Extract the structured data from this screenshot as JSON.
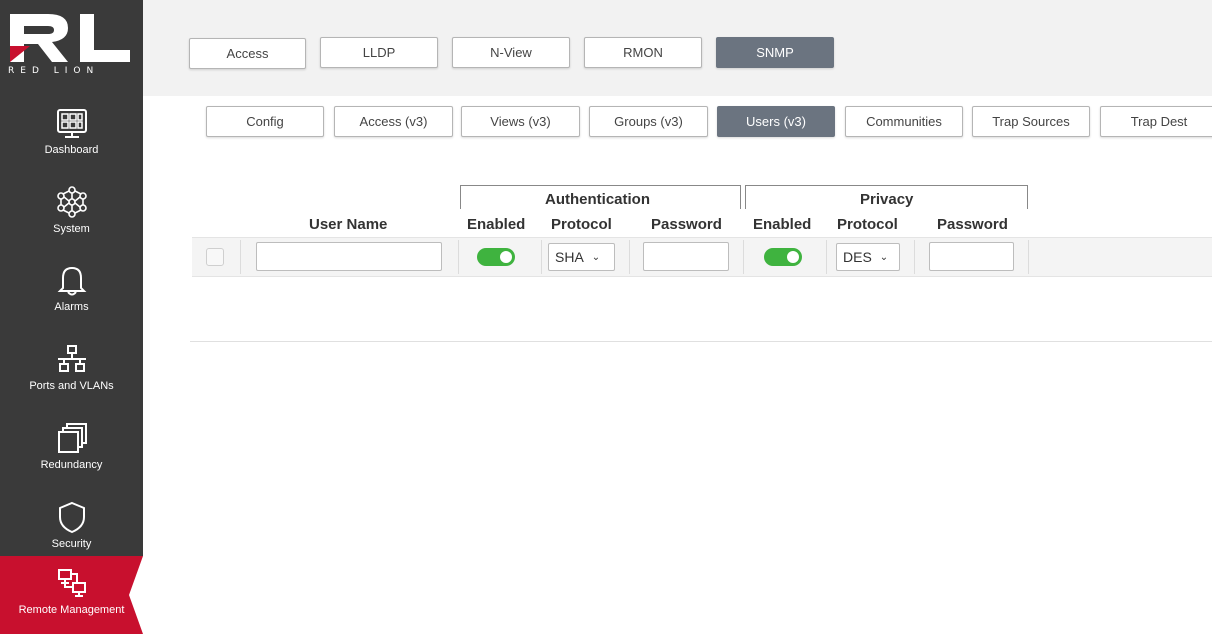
{
  "brand": {
    "wordmark": "RL",
    "name": "RED LION"
  },
  "colors": {
    "sidebar": "#3a3a3a",
    "accent": "#c8102e",
    "active_tab": "#6b7480",
    "toggle_on": "#3fb33f"
  },
  "sidebar": {
    "items": [
      {
        "label": "Dashboard",
        "icon": "dashboard-icon"
      },
      {
        "label": "System",
        "icon": "network-nodes-icon"
      },
      {
        "label": "Alarms",
        "icon": "bell-icon"
      },
      {
        "label": "Ports and VLANs",
        "icon": "port-tree-icon"
      },
      {
        "label": "Redundancy",
        "icon": "stacked-windows-icon"
      },
      {
        "label": "Security",
        "icon": "shield-icon"
      },
      {
        "label": "Remote Management",
        "icon": "remote-monitors-icon",
        "active": true
      }
    ]
  },
  "tabs_top": [
    {
      "label": "Access"
    },
    {
      "label": "LLDP"
    },
    {
      "label": "N-View"
    },
    {
      "label": "RMON"
    },
    {
      "label": "SNMP",
      "active": true
    }
  ],
  "tabs_sub": [
    {
      "label": "Config"
    },
    {
      "label": "Access (v3)"
    },
    {
      "label": "Views (v3)"
    },
    {
      "label": "Groups (v3)"
    },
    {
      "label": "Users (v3)",
      "active": true
    },
    {
      "label": "Communities"
    },
    {
      "label": "Trap Sources"
    },
    {
      "label": "Trap Dest"
    }
  ],
  "table": {
    "groups": {
      "authentication": "Authentication",
      "privacy": "Privacy"
    },
    "headers": {
      "user_name": "User Name",
      "auth_enabled": "Enabled",
      "auth_protocol": "Protocol",
      "auth_password": "Password",
      "priv_enabled": "Enabled",
      "priv_protocol": "Protocol",
      "priv_password": "Password"
    },
    "rows": [
      {
        "selected": false,
        "user_name": "",
        "auth_enabled": true,
        "auth_protocol": "SHA",
        "auth_password": "",
        "priv_enabled": true,
        "priv_protocol": "DES",
        "priv_password": ""
      }
    ]
  }
}
